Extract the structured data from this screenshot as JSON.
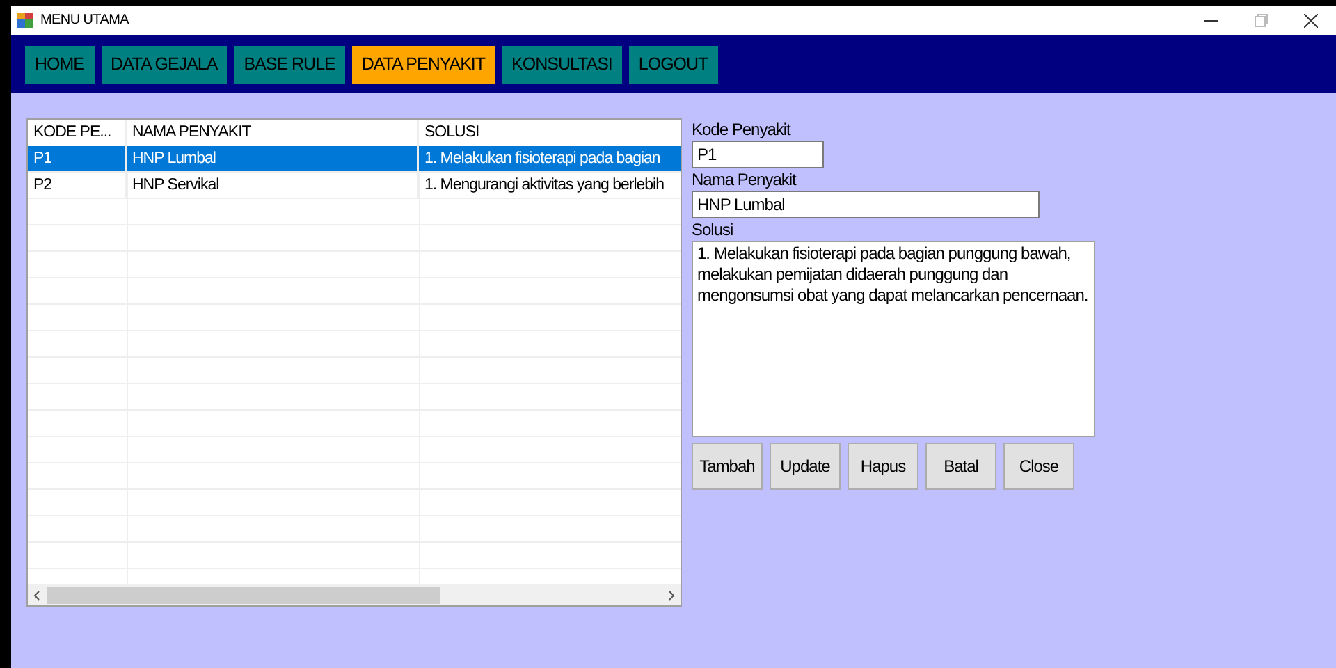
{
  "window": {
    "title": "MENU UTAMA"
  },
  "menu": [
    {
      "label": "HOME",
      "selected": false
    },
    {
      "label": "DATA GEJALA",
      "selected": false
    },
    {
      "label": "BASE RULE",
      "selected": false
    },
    {
      "label": "DATA PENYAKIT",
      "selected": true
    },
    {
      "label": "KONSULTASI",
      "selected": false
    },
    {
      "label": "LOGOUT",
      "selected": false
    }
  ],
  "table": {
    "columns": [
      "KODE PE...",
      "NAMA PENYAKIT",
      "SOLUSI"
    ],
    "rows": [
      {
        "cells": [
          "P1",
          "HNP Lumbal",
          "1. Melakukan fisioterapi pada bagian"
        ],
        "selected": true
      },
      {
        "cells": [
          "P2",
          "HNP Servikal",
          "1. Mengurangi aktivitas yang berlebih"
        ],
        "selected": false
      }
    ]
  },
  "form": {
    "fields": [
      {
        "label": "Kode Penyakit",
        "value": "P1",
        "kind": "short"
      },
      {
        "label": "Nama Penyakit",
        "value": "HNP Lumbal",
        "kind": "medium"
      },
      {
        "label": "Solusi",
        "value": "1. Melakukan fisioterapi pada bagian punggung bawah, melakukan pemijatan didaerah punggung dan mengonsumsi obat yang dapat melancarkan pencernaan.",
        "kind": "multiline"
      }
    ],
    "buttons": [
      "Tambah",
      "Update",
      "Hapus",
      "Batal",
      "Close"
    ]
  }
}
